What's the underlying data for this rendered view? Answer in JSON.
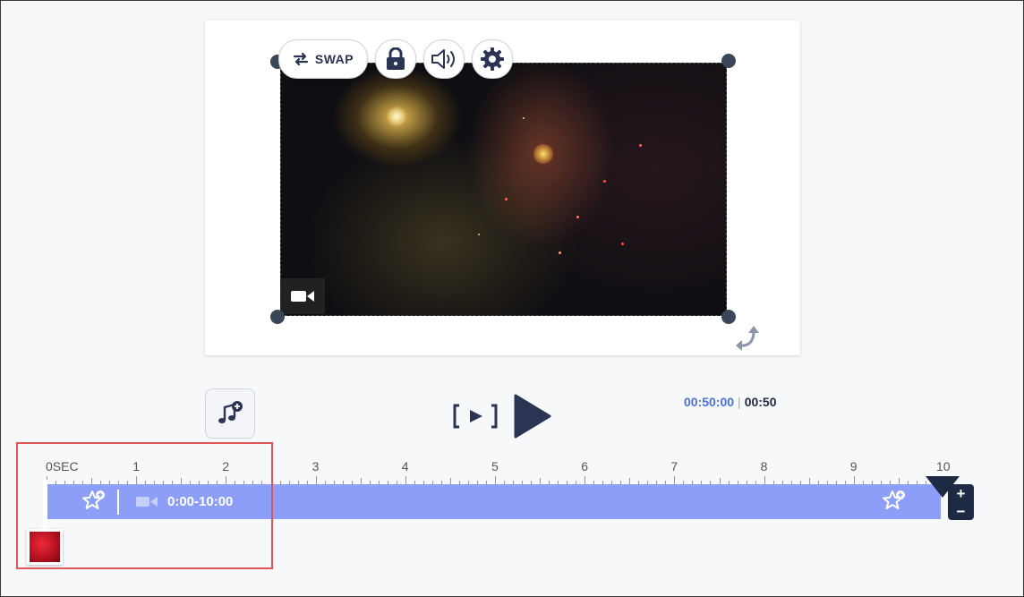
{
  "canvas": {
    "swap_label": "SWAP",
    "icons": [
      "swap-icon",
      "lock-icon",
      "volume-icon",
      "gear-icon",
      "video-camera-icon",
      "rotate-icon"
    ]
  },
  "controls": {
    "time_current": "00:50:00",
    "time_total": "00:50",
    "icons": [
      "add-music-icon",
      "trim-play-icon",
      "play-icon"
    ]
  },
  "timeline": {
    "ruler_labels": [
      "0SEC",
      "1",
      "2",
      "3",
      "4",
      "5",
      "6",
      "7",
      "8",
      "9",
      "10"
    ],
    "clip_range": "0:00-10:00",
    "zoom_in": "+",
    "zoom_out": "−"
  },
  "colors": {
    "accent": "#4b6fe0",
    "track": "#8c9ef8",
    "dark": "#1e2a44",
    "highlight": "#e05555"
  }
}
